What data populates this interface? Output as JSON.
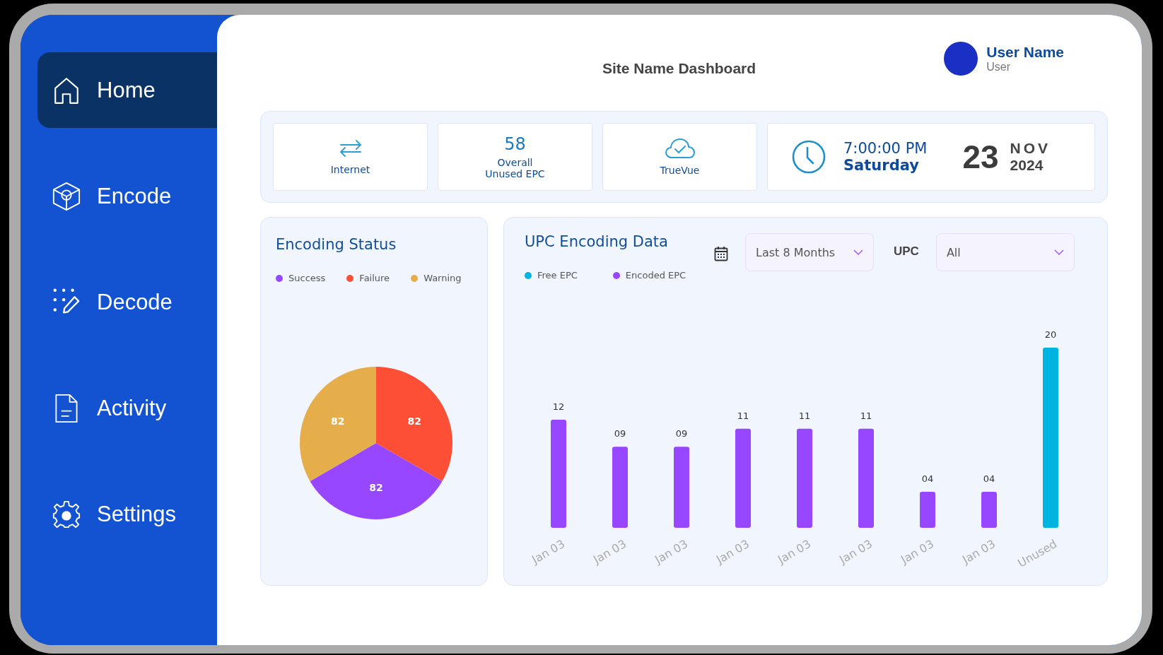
{
  "sidebar": {
    "items": [
      {
        "label": "Home",
        "selected": true
      },
      {
        "label": "Encode",
        "selected": false
      },
      {
        "label": "Decode",
        "selected": false
      },
      {
        "label": "Activity",
        "selected": false
      },
      {
        "label": "Settings",
        "selected": false
      }
    ]
  },
  "header": {
    "title": "Site Name Dashboard",
    "user": {
      "name": "User Name",
      "role": "User"
    }
  },
  "stats": [
    {
      "kind": "status",
      "label": "Internet"
    },
    {
      "kind": "count",
      "value": "58",
      "label": "Overall Unused EPC"
    },
    {
      "kind": "service",
      "label": "TrueVue"
    },
    {
      "kind": "datetime",
      "time": "7:00:00 PM",
      "day": "Saturday",
      "date": "23",
      "month": "NOV",
      "year": "2024"
    }
  ],
  "encoding_status": {
    "title": "Encoding Status",
    "chart_data": {
      "type": "pie",
      "categories": [
        "Success",
        "Failure",
        "Warning"
      ],
      "values": [
        82,
        82,
        82
      ],
      "colors": [
        "#9747ff",
        "#fc4f35",
        "#e6ae4a"
      ],
      "data_labels": true
    }
  },
  "upc_encoding": {
    "title": "UPC Encoding Data",
    "range": {
      "value": "Last 8 Months"
    },
    "upc": {
      "label": "UPC",
      "value": "All"
    },
    "legend": [
      {
        "label": "Free EPC",
        "color": "#00b4e0"
      },
      {
        "label": "Encoded EPC",
        "color": "#9747ff"
      }
    ],
    "chart_data": {
      "type": "bar",
      "categories": [
        "Jan 03",
        "Jan 03",
        "Jan 03",
        "Jan 03",
        "Jan 03",
        "Jan 03",
        "Jan 03",
        "Jan 03",
        "Unused"
      ],
      "values": [
        12,
        9,
        9,
        11,
        11,
        11,
        4,
        4,
        20
      ],
      "colors": [
        "#9747ff",
        "#9747ff",
        "#9747ff",
        "#9747ff",
        "#9747ff",
        "#9747ff",
        "#9747ff",
        "#9747ff",
        "#00b4e0"
      ],
      "value_labels": [
        "12",
        "09",
        "09",
        "11",
        "11",
        "11",
        "04",
        "04",
        "20"
      ]
    }
  }
}
